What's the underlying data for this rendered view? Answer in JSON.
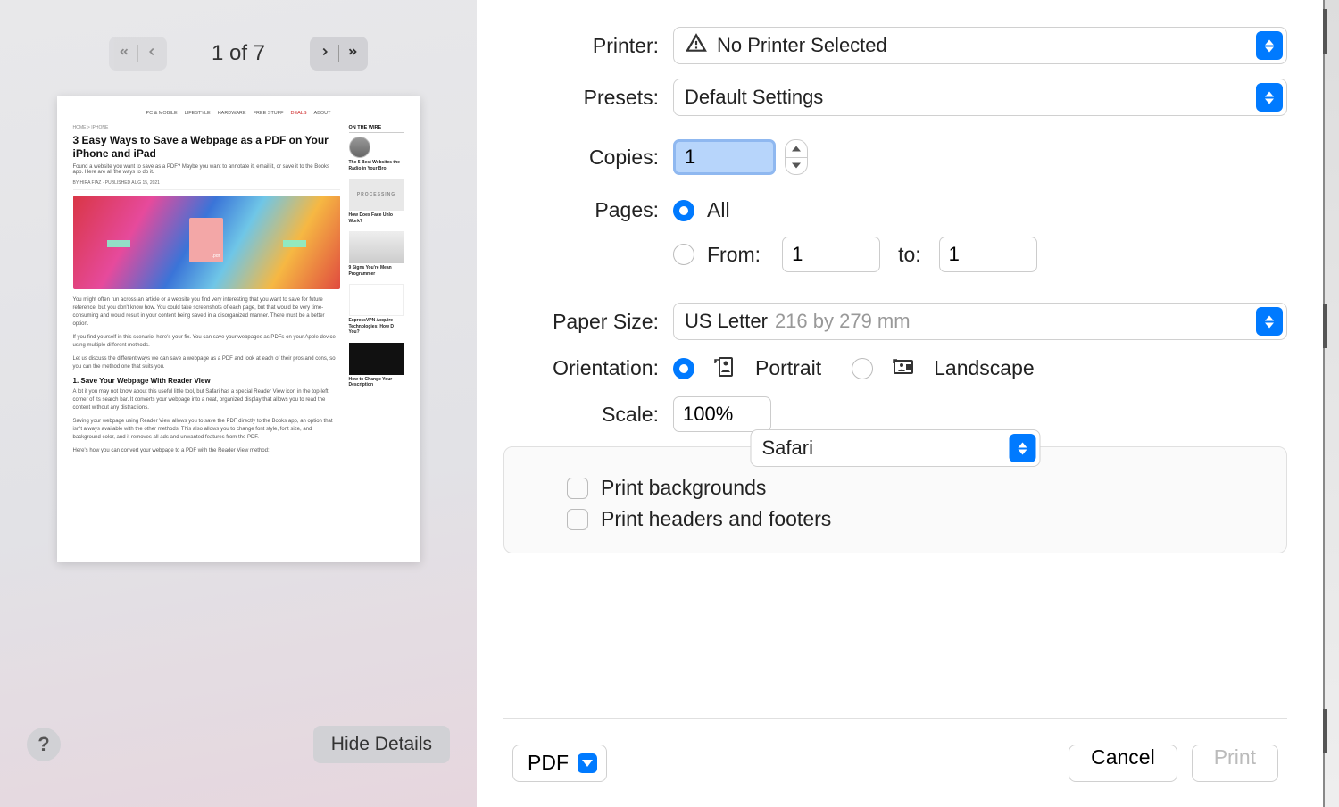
{
  "preview": {
    "page_indicator": "1 of 7",
    "help_symbol": "?",
    "details_button": "Hide Details",
    "thumbnail": {
      "nav_items": [
        "PC & MOBILE",
        "LIFESTYLE",
        "HARDWARE",
        "FREE STUFF",
        "DEALS",
        "ABOUT"
      ],
      "breadcrumb": "HOME > IPHONE",
      "title": "3 Easy Ways to Save a Webpage as a PDF on Your iPhone and iPad",
      "subtitle": "Found a website you want to save as a PDF? Maybe you want to annotate it, email it, or save it to the Books app. Here are all the ways to do it.",
      "meta": "BY HIRA FIAZ · PUBLISHED AUG 15, 2021",
      "p1": "You might often run across an article or a website you find very interesting that you want to save for future reference, but you don't know how. You could take screenshots of each page, but that would be very time-consuming and would result in your content being saved in a disorganized manner. There must be a better option.",
      "p2": "If you find yourself in this scenario, here's your fix. You can save your webpages as PDFs on your Apple device using multiple different methods.",
      "p3": "Let us discuss the different ways we can save a webpage as a PDF and look at each of their pros and cons, so you can the method one that suits you.",
      "h2": "1. Save Your Webpage With Reader View",
      "p4": "A lot if you may not know about this useful little tool, but Safari has a special Reader View icon in the top-left corner of its search bar. It converts your webpage into a neat, organized display that allows you to read the content without any distractions.",
      "p5": "Saving your webpage using Reader View allows you to save the PDF directly to the Books app, an option that isn't always available with the other methods. This also allows you to change font style, font size, and background color, and it removes all ads and unwanted features from the PDF.",
      "p6": "Here's how you can convert your webpage to a PDF with the Reader View method:",
      "sidebar_heading": "ON THE WIRE",
      "side_items": [
        "The 5 Best Websites the Radio in Your Bro",
        "How Does Face Unlo Work?",
        "9 Signs You're Mean Programmer",
        "ExpressVPN Acquire Technologies: How D You?",
        "How to Change Your Description"
      ],
      "proc_text": "PROCESSING"
    }
  },
  "form": {
    "printer_label": "Printer:",
    "printer_value": "No Printer Selected",
    "presets_label": "Presets:",
    "presets_value": "Default Settings",
    "copies_label": "Copies:",
    "copies_value": "1",
    "pages_label": "Pages:",
    "pages_all": "All",
    "pages_from": "From:",
    "pages_from_value": "1",
    "pages_to": "to:",
    "pages_to_value": "1",
    "paper_label": "Paper Size:",
    "paper_value": "US Letter",
    "paper_dim": "216 by 279 mm",
    "orientation_label": "Orientation:",
    "orientation_portrait": "Portrait",
    "orientation_landscape": "Landscape",
    "scale_label": "Scale:",
    "scale_value": "100%",
    "app_dropdown": "Safari",
    "check_backgrounds": "Print backgrounds",
    "check_headers": "Print headers and footers"
  },
  "footer": {
    "pdf": "PDF",
    "cancel": "Cancel",
    "print": "Print"
  }
}
